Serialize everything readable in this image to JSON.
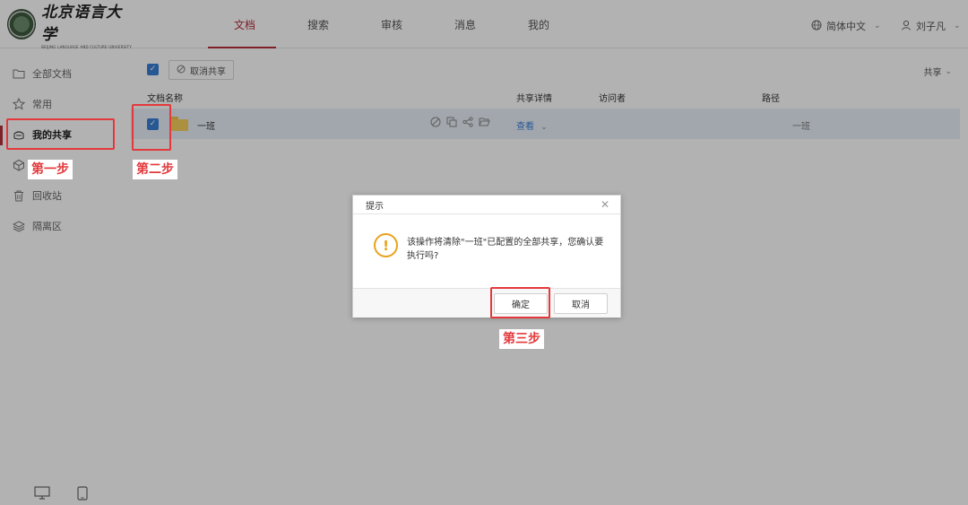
{
  "header": {
    "logo_cn": "北京语言大学",
    "logo_en": "BEIJING LANGUAGE AND CULTURE UNIVERSITY",
    "nav": [
      "文档",
      "搜索",
      "审核",
      "消息",
      "我的"
    ],
    "active_nav": "文档",
    "language": "简体中文",
    "user": "刘子凡"
  },
  "sidebar": {
    "items": [
      "全部文档",
      "常用",
      "我的共享",
      "",
      "回收站",
      "隔离区"
    ],
    "active": "我的共享"
  },
  "toolbar": {
    "cancel_share_label": "取消共享",
    "filter_label": "共享"
  },
  "table": {
    "columns": [
      "文档名称",
      "共享详情",
      "访问者",
      "路径"
    ],
    "rows": [
      {
        "name": "一班",
        "detail": "查看",
        "visitor": "",
        "path": "一班"
      }
    ]
  },
  "dialog": {
    "title": "提示",
    "message": "该操作将清除\"一班\"已配置的全部共享，您确认要执行吗?",
    "ok_label": "确定",
    "cancel_label": "取消"
  },
  "annotations": {
    "step1": "第一步",
    "step2": "第二步",
    "step3": "第三步"
  },
  "colors": {
    "brand": "#b5303b",
    "link": "#3a7fd5",
    "annotation": "#e3393c",
    "warning": "#e8a21c"
  }
}
